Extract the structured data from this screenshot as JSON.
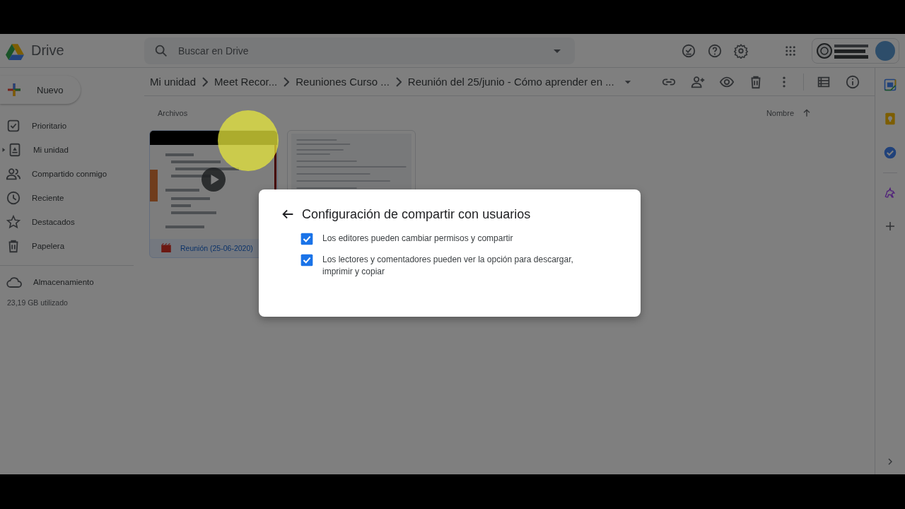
{
  "app": {
    "name": "Drive"
  },
  "search": {
    "placeholder": "Buscar en Drive"
  },
  "new_button": {
    "label": "Nuevo"
  },
  "sidebar": {
    "items": [
      {
        "label": "Prioritario",
        "kind": "link"
      },
      {
        "label": "Mi unidad",
        "kind": "tree"
      },
      {
        "label": "Compartido conmigo",
        "kind": "link"
      },
      {
        "label": "Reciente",
        "kind": "link"
      },
      {
        "label": "Destacados",
        "kind": "link"
      },
      {
        "label": "Papelera",
        "kind": "link"
      }
    ],
    "storage": {
      "label": "Almacenamiento",
      "usage": "23,19 GB utilizado"
    }
  },
  "breadcrumb": [
    "Mi unidad",
    "Meet Recor...",
    "Reuniones Curso ...",
    "Reunión del 25/junio - Cómo aprender en ..."
  ],
  "section_title": "Archivos",
  "sort": {
    "label": "Nombre"
  },
  "files": [
    {
      "kind": "video",
      "name": "Reunión (25-06-2020)",
      "selected": true
    },
    {
      "kind": "document",
      "selected": false
    }
  ],
  "dialog": {
    "title": "Configuración de compartir con usuarios",
    "options": [
      {
        "label": "Los editores pueden cambiar permisos y compartir",
        "checked": true
      },
      {
        "label": "Los lectores y comentadores pueden ver la opción para descargar, imprimir y copiar",
        "checked": true
      }
    ]
  }
}
